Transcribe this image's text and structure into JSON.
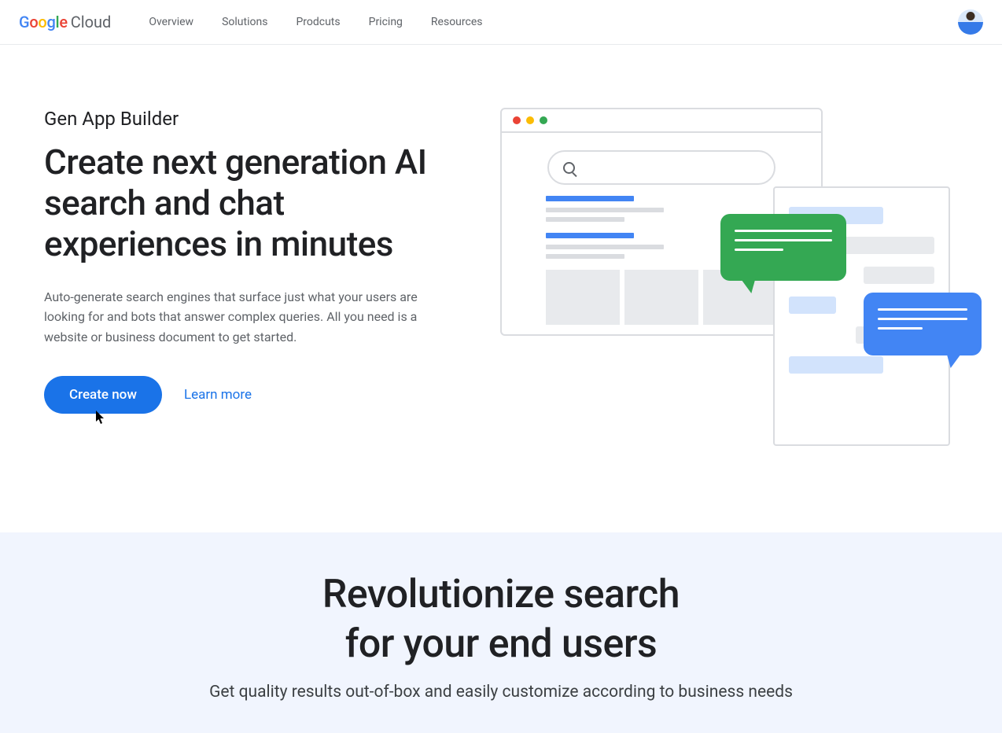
{
  "brand": {
    "cloud_label": "Cloud"
  },
  "nav": {
    "items": [
      "Overview",
      "Solutions",
      "Prodcuts",
      "Pricing",
      "Resources"
    ]
  },
  "hero": {
    "eyebrow": "Gen App Builder",
    "title": "Create next generation AI search and chat experiences in minutes",
    "description": "Auto-generate search engines that surface just what your users are looking for and bots that answer complex queries. All you need is a website or business document to get started.",
    "cta_primary": "Create now",
    "cta_secondary": "Learn more"
  },
  "section2": {
    "title_line1": "Revolutionize search",
    "title_line2": "for your end users",
    "subtitle": "Get quality results out-of-box and easily customize according to business needs"
  }
}
